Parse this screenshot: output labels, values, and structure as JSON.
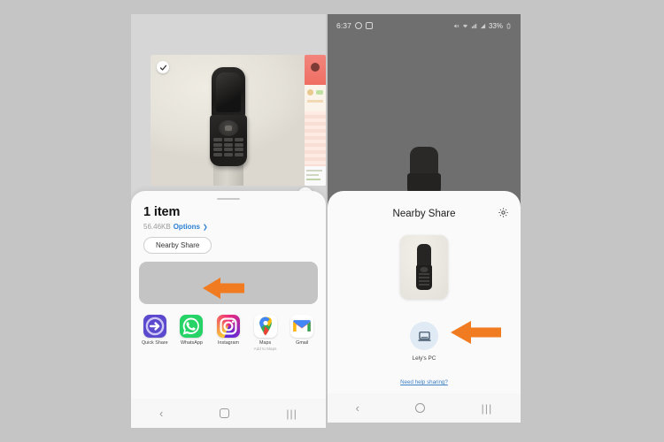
{
  "background_color": "#c5c5c5",
  "accent_arrow_color": "#f07b21",
  "left_phone": {
    "name": "android-share-sheet-screen",
    "photo": {
      "checkmark_icon": "check-circle-icon",
      "edit_icon": "image-edit-icon",
      "subject": "black flip phone on beige pedestal"
    },
    "share_sheet": {
      "title": "1 item",
      "size": "56.46KB",
      "options_label": "Options",
      "options_chevron": "chevron-right-icon",
      "nearby_share_button": "Nearby Share",
      "apps": [
        {
          "name": "Quick Share",
          "sub": "",
          "icon": "quick-share-icon"
        },
        {
          "name": "WhatsApp",
          "sub": "",
          "icon": "whatsapp-icon"
        },
        {
          "name": "Instagram",
          "sub": "",
          "icon": "instagram-icon"
        },
        {
          "name": "Maps",
          "sub": "Add to Maps",
          "icon": "google-maps-icon"
        },
        {
          "name": "Gmail",
          "sub": "",
          "icon": "gmail-icon"
        }
      ]
    },
    "navbar": {
      "back": "‹",
      "home_icon": "home-square-icon",
      "recents": "|||"
    }
  },
  "right_phone": {
    "name": "nearby-share-picker-screen",
    "statusbar": {
      "time": "6:37",
      "notification_icons": [
        "whatsapp-icon",
        "instagram-icon"
      ],
      "system_icons": [
        "mute-icon",
        "wifi-icon",
        "signal-icon",
        "signal-bars-icon"
      ],
      "battery": "33%",
      "battery_icon": "battery-icon"
    },
    "panel": {
      "title": "Nearby Share",
      "settings_icon": "gear-icon",
      "thumbnail": "flip phone photo thumbnail",
      "devices": [
        {
          "name": "Lely's PC",
          "icon": "laptop-icon"
        }
      ],
      "help_link": "Need help sharing?"
    },
    "navbar": {
      "back": "‹",
      "home_icon": "home-square-icon",
      "recents": "|||"
    }
  },
  "annotations": [
    {
      "name": "arrow-to-nearby-share-button",
      "direction": "left",
      "color": "#f07b21"
    },
    {
      "name": "arrow-to-device-lelys-pc",
      "direction": "left",
      "color": "#f07b21"
    }
  ]
}
